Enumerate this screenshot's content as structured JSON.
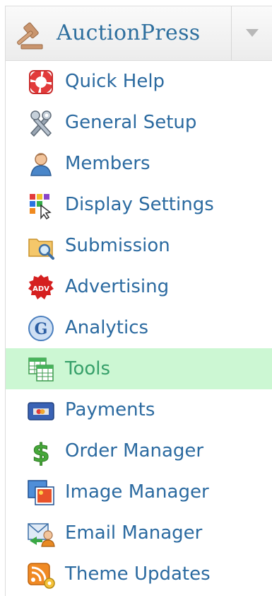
{
  "header": {
    "title": "AuctionPress"
  },
  "menu": {
    "items": [
      {
        "label": "Quick Help",
        "icon": "lifebuoy-icon"
      },
      {
        "label": "General Setup",
        "icon": "tools-icon"
      },
      {
        "label": "Members",
        "icon": "user-icon"
      },
      {
        "label": "Display Settings",
        "icon": "layout-icon"
      },
      {
        "label": "Submission",
        "icon": "folder-search-icon"
      },
      {
        "label": "Advertising",
        "icon": "adv-badge-icon"
      },
      {
        "label": "Analytics",
        "icon": "google-icon"
      },
      {
        "label": "Tools",
        "icon": "spreadsheet-icon",
        "active": true
      },
      {
        "label": "Payments",
        "icon": "credit-card-icon"
      },
      {
        "label": "Order Manager",
        "icon": "dollar-icon"
      },
      {
        "label": "Image Manager",
        "icon": "image-icon"
      },
      {
        "label": "Email Manager",
        "icon": "email-user-icon"
      },
      {
        "label": "Theme Updates",
        "icon": "rss-icon"
      }
    ]
  },
  "colors": {
    "link": "#2b6aa0",
    "active_bg": "#ccf7d3",
    "active_text": "#37a06a",
    "title": "#2e6f9e"
  }
}
